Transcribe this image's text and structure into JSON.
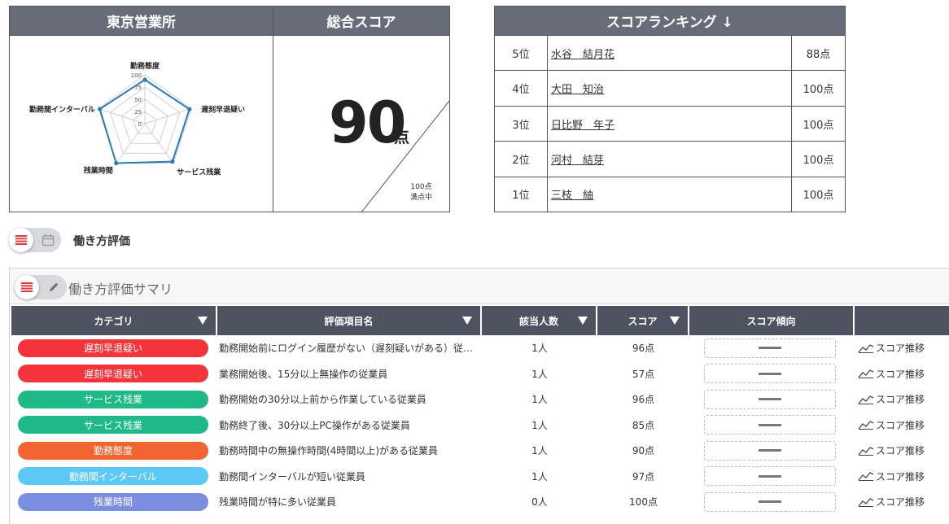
{
  "office": {
    "title": "東京営業所",
    "radar": {
      "axes": [
        "勤務態度",
        "遅刻早退疑い",
        "サービス残業",
        "残業時間",
        "勤務間インターバル"
      ],
      "ticks": [
        "100",
        "75",
        "50",
        "25",
        "0"
      ],
      "values": [
        90,
        96,
        96,
        100,
        97
      ],
      "line_color": "#2b7bb9"
    }
  },
  "score": {
    "title": "総合スコア",
    "value": "90",
    "unit": "点",
    "max_line1": "100点",
    "max_line2": "満点中"
  },
  "ranking": {
    "title": "スコアランキング ↓",
    "rows": [
      {
        "pos": "5位",
        "name": "水谷　結月花",
        "pts": "88点"
      },
      {
        "pos": "4位",
        "name": "大田　知治",
        "pts": "100点"
      },
      {
        "pos": "3位",
        "name": "日比野　年子",
        "pts": "100点"
      },
      {
        "pos": "2位",
        "name": "河村　結芽",
        "pts": "100点"
      },
      {
        "pos": "1位",
        "name": "三枝　紬",
        "pts": "100点"
      }
    ]
  },
  "section": {
    "title": "働き方評価"
  },
  "summary": {
    "title": "働き方評価サマリ",
    "headers": [
      "カテゴリ",
      "評価項目名",
      "該当人数",
      "スコア",
      "スコア傾向",
      ""
    ],
    "rows": [
      {
        "category": "遅刻早退疑い",
        "color": "#f5333b",
        "item": "勤務開始前にログイン履歴がない（遅刻疑いがある）従…",
        "count": "1人",
        "score": "96点",
        "link": "スコア推移"
      },
      {
        "category": "遅刻早退疑い",
        "color": "#f5333b",
        "item": "業務開始後、15分以上無操作の従業員",
        "count": "1人",
        "score": "57点",
        "link": "スコア推移"
      },
      {
        "category": "サービス残業",
        "color": "#1fb987",
        "item": "勤務開始の30分以上前から作業している従業員",
        "count": "1人",
        "score": "96点",
        "link": "スコア推移"
      },
      {
        "category": "サービス残業",
        "color": "#1fb987",
        "item": "勤務終了後、30分以上PC操作がある従業員",
        "count": "1人",
        "score": "85点",
        "link": "スコア推移"
      },
      {
        "category": "勤務態度",
        "color": "#f26430",
        "item": "勤務時間中の無操作時間(4時間以上)がある従業員",
        "count": "1人",
        "score": "90点",
        "link": "スコア推移"
      },
      {
        "category": "勤務間インターバル",
        "color": "#5bc8f5",
        "item": "勤務間インターバルが短い従業員",
        "count": "1人",
        "score": "97点",
        "link": "スコア推移"
      },
      {
        "category": "残業時間",
        "color": "#7b8ee0",
        "item": "残業時間が特に多い従業員",
        "count": "0人",
        "score": "100点",
        "link": "スコア推移"
      }
    ]
  }
}
